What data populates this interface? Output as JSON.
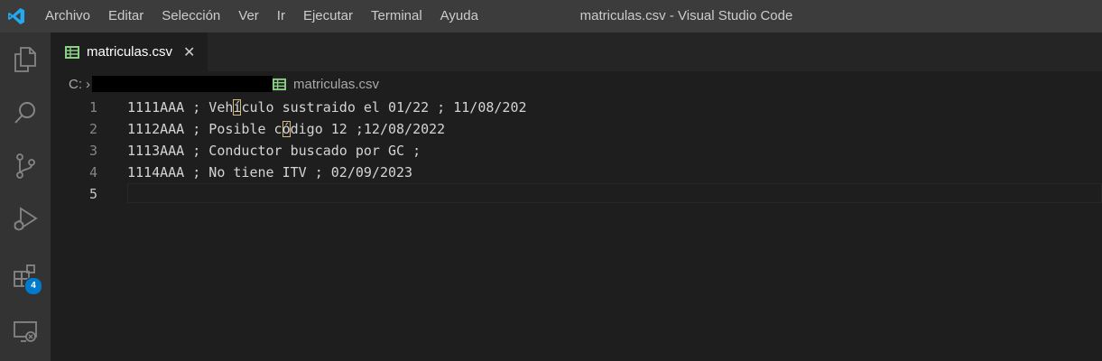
{
  "window_title": "matriculas.csv - Visual Studio Code",
  "menu": [
    "Archivo",
    "Editar",
    "Selección",
    "Ver",
    "Ir",
    "Ejecutar",
    "Terminal",
    "Ayuda"
  ],
  "activity_bar": {
    "items": [
      "explorer-icon",
      "search-icon",
      "source-control-icon",
      "run-debug-icon",
      "extensions-icon",
      "remote-explorer-icon"
    ],
    "extensions_badge": "4"
  },
  "tab": {
    "label": "matriculas.csv",
    "close": "✕"
  },
  "breadcrumb": {
    "drive": "C:",
    "separator": "›",
    "file": "matriculas.csv"
  },
  "editor": {
    "line_numbers": [
      "1",
      "2",
      "3",
      "4",
      "5"
    ],
    "lines": [
      {
        "before": "1111AAA ; Veh",
        "highlight": "í",
        "after": "culo sustraido el 01/22 ; 11/08/202"
      },
      {
        "before": "1112AAA ; Posible c",
        "highlight": "ó",
        "after": "digo 12 ;12/08/2022"
      },
      {
        "before": "1113AAA ; Conductor buscado por GC ;",
        "highlight": "",
        "after": ""
      },
      {
        "before": "1114AAA ; No tiene ITV ; 02/09/2023",
        "highlight": "",
        "after": ""
      },
      {
        "before": "",
        "highlight": "",
        "after": ""
      }
    ]
  },
  "colors": {
    "titlebar": "#3c3c3c",
    "activitybar": "#333333",
    "editor": "#1e1e1e",
    "accent": "#007acc",
    "csv_icon": "#89d185"
  }
}
